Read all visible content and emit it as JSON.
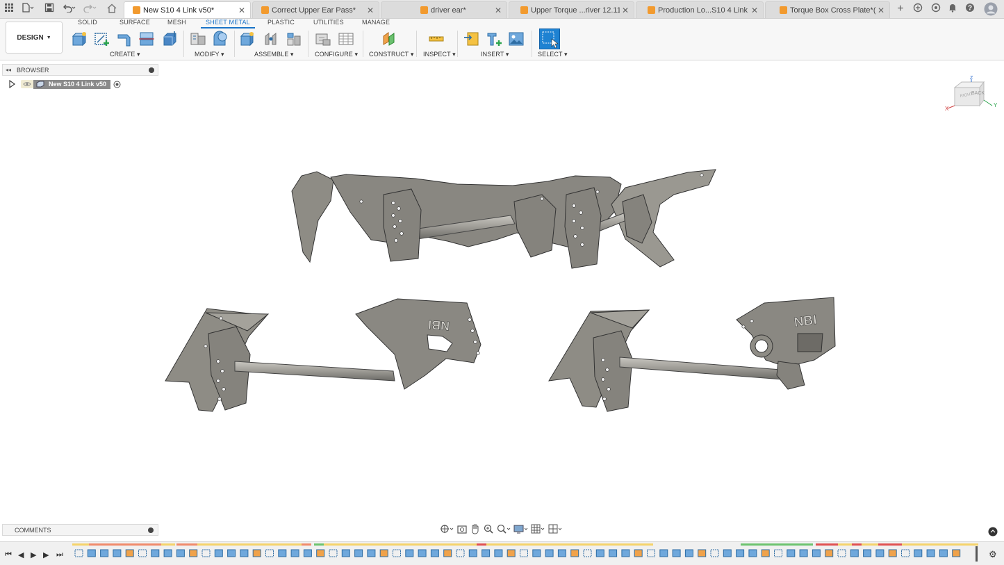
{
  "tabs": [
    {
      "label": "New S10 4 Link v50*",
      "active": true
    },
    {
      "label": "Correct Upper Ear Pass*",
      "active": false
    },
    {
      "label": "driver ear*",
      "active": false
    },
    {
      "label": "Upper Torque ...river  12.11*",
      "active": false
    },
    {
      "label": "Production Lo...S10 4 Link v1",
      "active": false
    },
    {
      "label": "Torque Box Cross Plate*(1)",
      "active": false
    }
  ],
  "workspace": {
    "label": "DESIGN"
  },
  "ribbon_tabs": [
    {
      "label": "SOLID",
      "active": false
    },
    {
      "label": "SURFACE",
      "active": false
    },
    {
      "label": "MESH",
      "active": false
    },
    {
      "label": "SHEET METAL",
      "active": true
    },
    {
      "label": "PLASTIC",
      "active": false
    },
    {
      "label": "UTILITIES",
      "active": false
    },
    {
      "label": "MANAGE",
      "active": false
    }
  ],
  "groups": {
    "create": "CREATE",
    "modify": "MODIFY",
    "assemble": "ASSEMBLE",
    "configure": "CONFIGURE",
    "construct": "CONSTRUCT",
    "inspect": "INSPECT",
    "insert": "INSERT",
    "select": "SELECT"
  },
  "browser": {
    "title": "BROWSER",
    "root_node": "New S10 4 Link v50"
  },
  "comments": {
    "title": "COMMENTS"
  },
  "viewcube": {
    "right": "RIGHT",
    "back": "BACK",
    "axis_x": "X",
    "axis_y": "Y",
    "axis_z": "Z"
  },
  "colors": {
    "accent": "#1a73c8",
    "tab_cube": "#f29a2e",
    "part_metal": "#8e8c85"
  },
  "icons": {
    "apps": "grid-icon",
    "file": "file-icon",
    "save": "save-icon",
    "undo": "undo-icon",
    "redo": "redo-icon",
    "home": "home-icon",
    "new_tab": "plus-icon",
    "help": "help-icon",
    "notifications": "bell-icon"
  }
}
